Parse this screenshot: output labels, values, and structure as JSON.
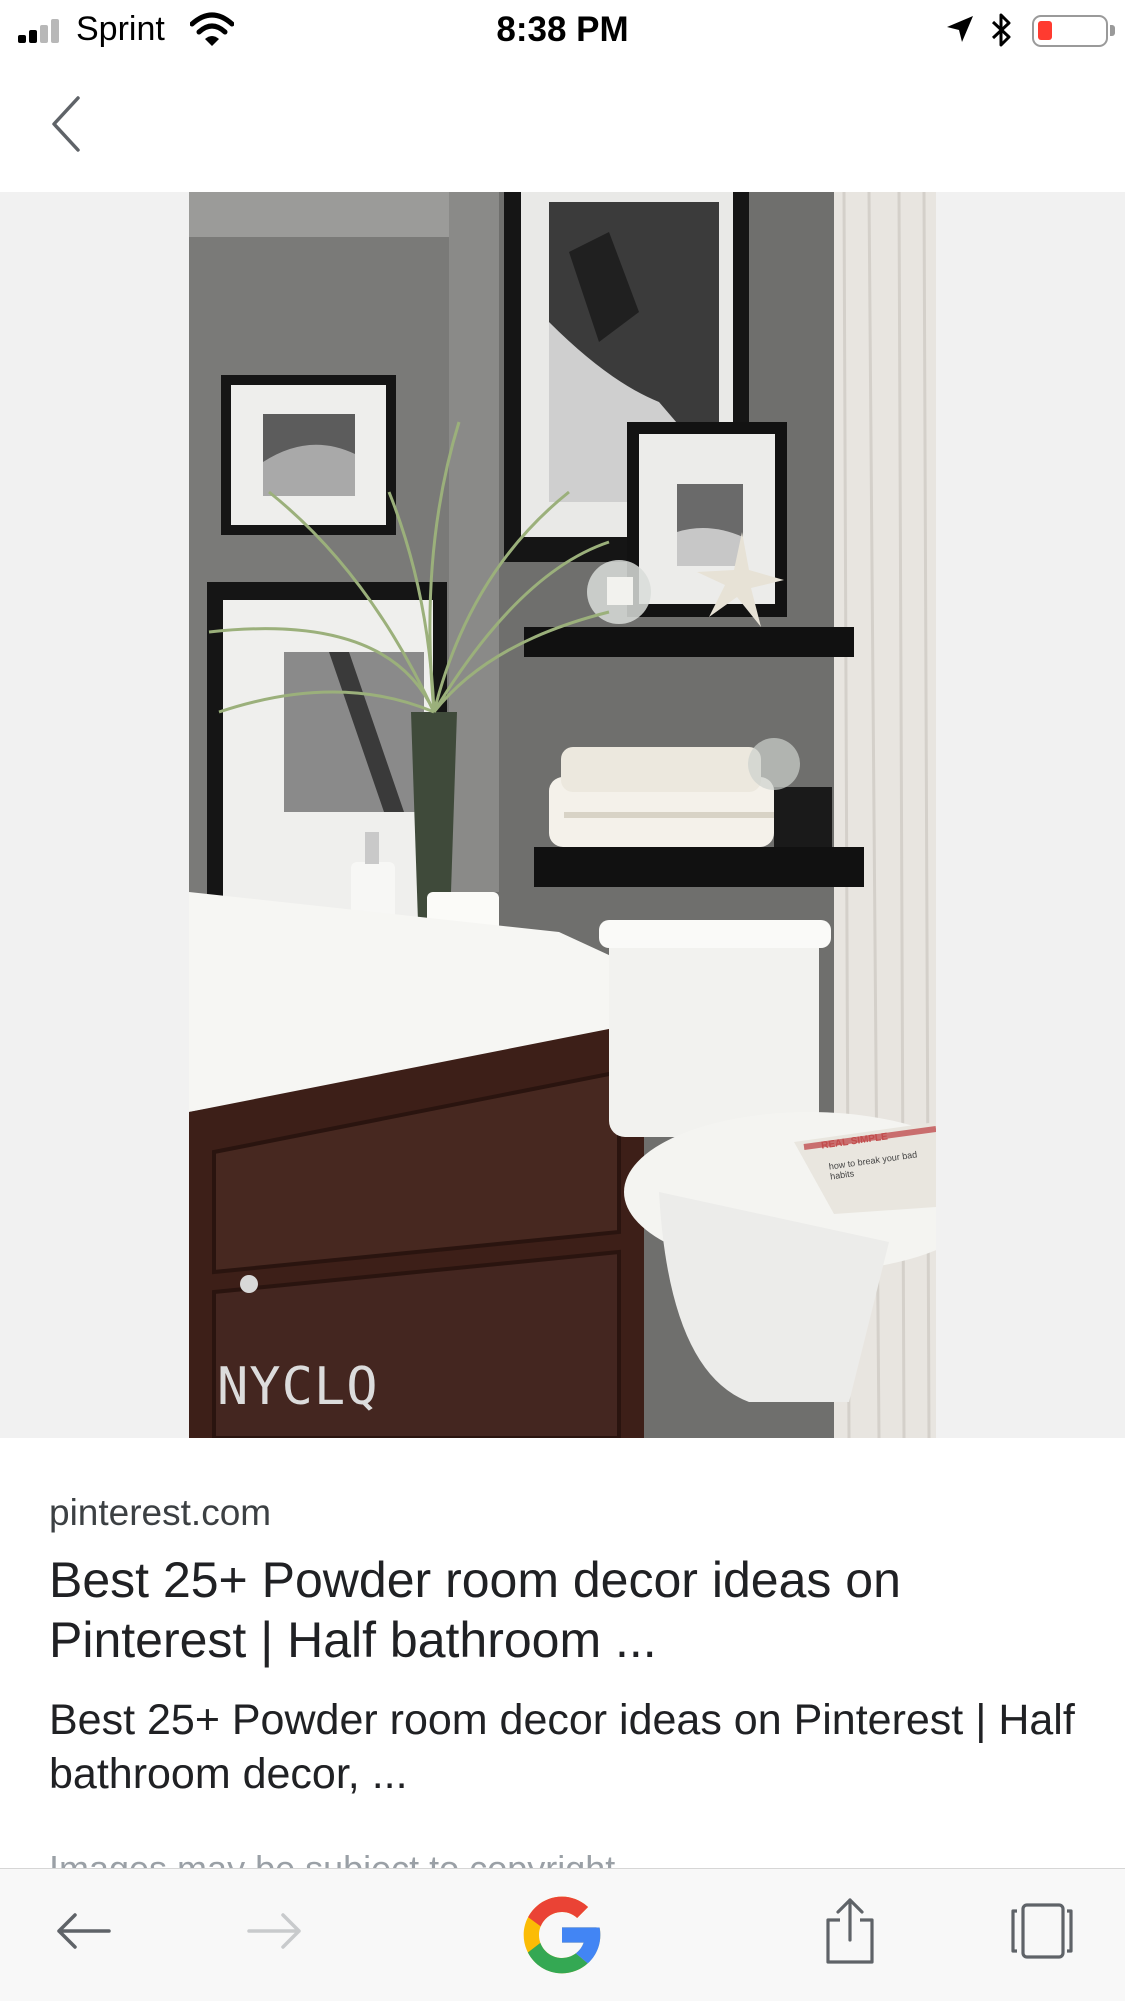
{
  "status_bar": {
    "carrier": "Sprint",
    "time": "8:38 PM",
    "battery_level": 0.15,
    "battery_color": "#ff3b30",
    "signal_bars": 2,
    "icons": [
      "signal-icon",
      "wifi-icon",
      "location-arrow-icon",
      "bluetooth-icon",
      "battery-icon"
    ]
  },
  "header": {
    "back_icon": "chevron-left-icon"
  },
  "image": {
    "watermark": "NYCLQ",
    "magazine_brand": "REAL SIMPLE",
    "magazine_headline": "how to break your bad habits"
  },
  "result": {
    "source": "pinterest.com",
    "title": "Best 25+ Powder room decor ideas on Pinterest | Half bathroom ...",
    "snippet": "Best 25+ Powder room decor ideas on Pinterest | Half bathroom decor, ...",
    "copyright_notice": "Images may be subject to copyright."
  },
  "toolbar": {
    "buttons": [
      "back-arrow-icon",
      "forward-arrow-icon",
      "google-logo-icon",
      "share-icon",
      "tabs-icon"
    ],
    "forward_enabled": false,
    "google_colors": [
      "#4285F4",
      "#EA4335",
      "#FBBC05",
      "#34A853"
    ]
  }
}
